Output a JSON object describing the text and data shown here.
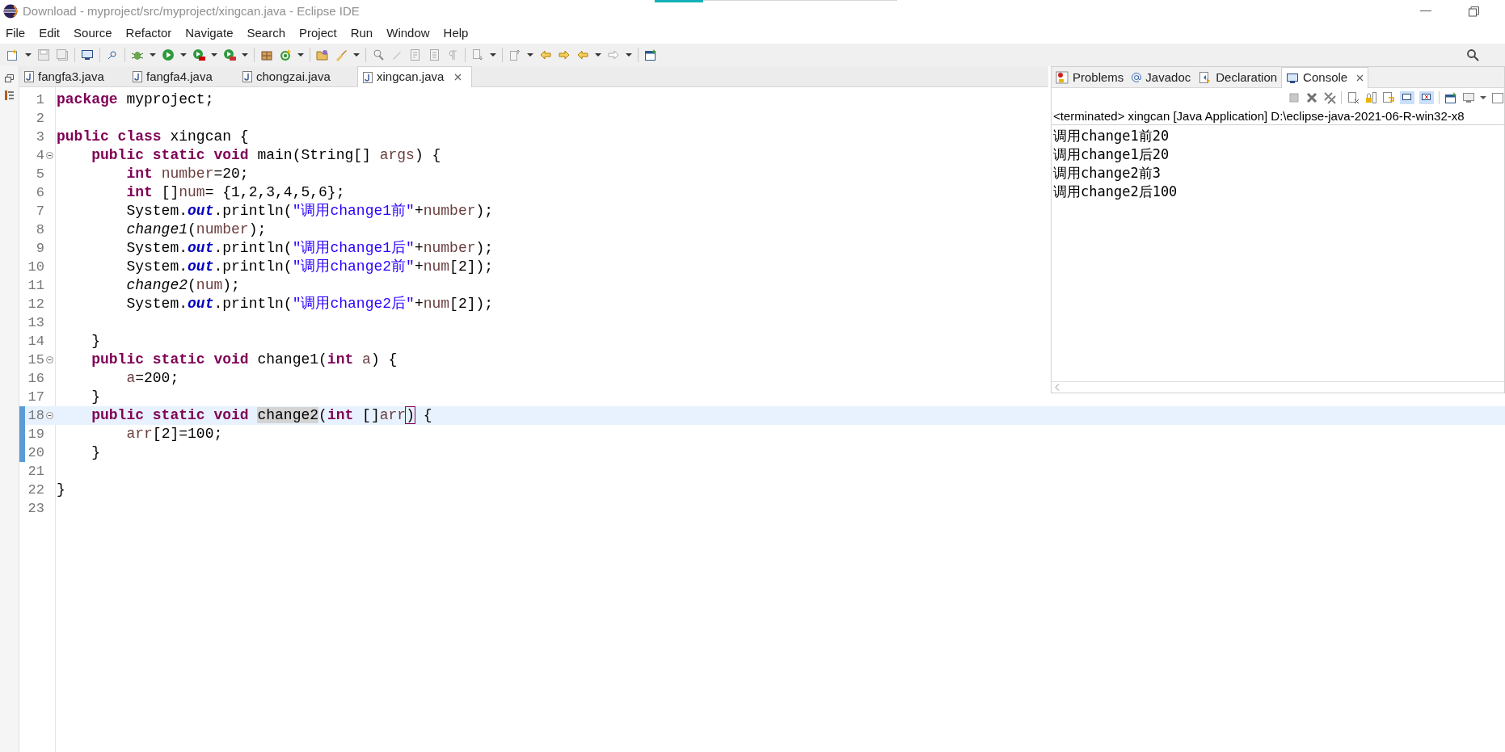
{
  "window": {
    "title": "Download - myproject/src/myproject/xingcan.java - Eclipse IDE"
  },
  "menu": [
    "File",
    "Edit",
    "Source",
    "Refactor",
    "Navigate",
    "Search",
    "Project",
    "Run",
    "Window",
    "Help"
  ],
  "editor_tabs": [
    {
      "label": "fangfa3.java",
      "selected": false
    },
    {
      "label": "fangfa4.java",
      "selected": false
    },
    {
      "label": "chongzai.java",
      "selected": false
    },
    {
      "label": "xingcan.java",
      "selected": true
    }
  ],
  "editor": {
    "lines": [
      {
        "number": "1",
        "fold": false,
        "changed": false,
        "current": false,
        "tokens": [
          {
            "kind": "keyword",
            "text": "package"
          },
          {
            "kind": "plain",
            "text": " myproject;"
          }
        ]
      },
      {
        "number": "2",
        "fold": false,
        "changed": false,
        "current": false
      },
      {
        "number": "3",
        "fold": false,
        "changed": false,
        "current": false,
        "tokens": [
          {
            "kind": "keyword",
            "text": "public class"
          },
          {
            "kind": "plain",
            "text": " xingcan {"
          }
        ]
      },
      {
        "number": "4",
        "fold": true,
        "changed": false,
        "current": false,
        "tokens": [
          {
            "kind": "keyword",
            "text": "    public static void"
          },
          {
            "kind": "plain",
            "text": " main(String[] "
          },
          {
            "kind": "variable",
            "text": "args"
          },
          {
            "kind": "plain",
            "text": ") {"
          }
        ]
      },
      {
        "number": "5",
        "fold": false,
        "changed": false,
        "current": false,
        "tokens": [
          {
            "kind": "keyword",
            "text": "        int "
          },
          {
            "kind": "variable",
            "text": "number"
          },
          {
            "kind": "plain",
            "text": "=20;"
          }
        ]
      },
      {
        "number": "6",
        "fold": false,
        "changed": false,
        "current": false,
        "tokens": [
          {
            "kind": "keyword",
            "text": "        int "
          },
          {
            "kind": "plain",
            "text": "[]"
          },
          {
            "kind": "variable",
            "text": "num"
          },
          {
            "kind": "plain",
            "text": "= {1,2,3,4,5,6};"
          }
        ]
      },
      {
        "number": "7",
        "fold": false,
        "changed": false,
        "current": false,
        "tokens": [
          {
            "kind": "plain",
            "text": "        System."
          },
          {
            "kind": "field",
            "text": "out"
          },
          {
            "kind": "plain",
            "text": ".println("
          },
          {
            "kind": "string",
            "text": "\"调用change1前\""
          },
          {
            "kind": "plain",
            "text": "+"
          },
          {
            "kind": "variable",
            "text": "number"
          },
          {
            "kind": "plain",
            "text": ");"
          }
        ]
      },
      {
        "number": "8",
        "fold": false,
        "changed": false,
        "current": false,
        "tokens": [
          {
            "kind": "static",
            "text": "        change1"
          },
          {
            "kind": "plain",
            "text": "("
          },
          {
            "kind": "variable",
            "text": "number"
          },
          {
            "kind": "plain",
            "text": ");"
          }
        ]
      },
      {
        "number": "9",
        "fold": false,
        "changed": false,
        "current": false,
        "tokens": [
          {
            "kind": "plain",
            "text": "        System."
          },
          {
            "kind": "field",
            "text": "out"
          },
          {
            "kind": "plain",
            "text": ".println("
          },
          {
            "kind": "string",
            "text": "\"调用change1后\""
          },
          {
            "kind": "plain",
            "text": "+"
          },
          {
            "kind": "variable",
            "text": "number"
          },
          {
            "kind": "plain",
            "text": ");"
          }
        ]
      },
      {
        "number": "10",
        "fold": false,
        "changed": false,
        "current": false,
        "tokens": [
          {
            "kind": "plain",
            "text": "        System."
          },
          {
            "kind": "field",
            "text": "out"
          },
          {
            "kind": "plain",
            "text": ".println("
          },
          {
            "kind": "string",
            "text": "\"调用change2前\""
          },
          {
            "kind": "plain",
            "text": "+"
          },
          {
            "kind": "variable",
            "text": "num"
          },
          {
            "kind": "plain",
            "text": "[2]);"
          }
        ]
      },
      {
        "number": "11",
        "fold": false,
        "changed": false,
        "current": false,
        "tokens": [
          {
            "kind": "static",
            "text": "        change2"
          },
          {
            "kind": "plain",
            "text": "("
          },
          {
            "kind": "variable",
            "text": "num"
          },
          {
            "kind": "plain",
            "text": ");"
          }
        ]
      },
      {
        "number": "12",
        "fold": false,
        "changed": false,
        "current": false,
        "tokens": [
          {
            "kind": "plain",
            "text": "        System."
          },
          {
            "kind": "field",
            "text": "out"
          },
          {
            "kind": "plain",
            "text": ".println("
          },
          {
            "kind": "string",
            "text": "\"调用change2后\""
          },
          {
            "kind": "plain",
            "text": "+"
          },
          {
            "kind": "variable",
            "text": "num"
          },
          {
            "kind": "plain",
            "text": "[2]);"
          }
        ]
      },
      {
        "number": "13",
        "fold": false,
        "changed": false,
        "current": false
      },
      {
        "number": "14",
        "fold": false,
        "changed": false,
        "current": false,
        "tokens": [
          {
            "kind": "plain",
            "text": "    }"
          }
        ]
      },
      {
        "number": "15",
        "fold": true,
        "changed": false,
        "current": false,
        "tokens": [
          {
            "kind": "keyword",
            "text": "    public static void"
          },
          {
            "kind": "plain",
            "text": " change1("
          },
          {
            "kind": "keyword",
            "text": "int "
          },
          {
            "kind": "variable",
            "text": "a"
          },
          {
            "kind": "plain",
            "text": ") {"
          }
        ]
      },
      {
        "number": "16",
        "fold": false,
        "changed": false,
        "current": false,
        "tokens": [
          {
            "kind": "variable",
            "text": "        a"
          },
          {
            "kind": "plain",
            "text": "=200;"
          }
        ]
      },
      {
        "number": "17",
        "fold": false,
        "changed": false,
        "current": false,
        "tokens": [
          {
            "kind": "plain",
            "text": "    }"
          }
        ]
      },
      {
        "number": "18",
        "fold": true,
        "changed": true,
        "current": true,
        "tokens": [
          {
            "kind": "keyword",
            "text": "    public static void "
          },
          {
            "kind": "occurrence",
            "text": "change2"
          },
          {
            "kind": "plain",
            "text": "("
          },
          {
            "kind": "keyword",
            "text": "int "
          },
          {
            "kind": "plain",
            "text": "[]"
          },
          {
            "kind": "variable",
            "text": "arr"
          },
          {
            "kind": "bracket",
            "text": ")"
          },
          {
            "kind": "plain",
            "text": " {"
          }
        ]
      },
      {
        "number": "19",
        "fold": false,
        "changed": true,
        "current": false,
        "tokens": [
          {
            "kind": "variable",
            "text": "        arr"
          },
          {
            "kind": "plain",
            "text": "[2]=100;"
          }
        ]
      },
      {
        "number": "20",
        "fold": false,
        "changed": true,
        "current": false,
        "tokens": [
          {
            "kind": "plain",
            "text": "    }"
          }
        ]
      },
      {
        "number": "21",
        "fold": false,
        "changed": false,
        "current": false
      },
      {
        "number": "22",
        "fold": false,
        "changed": false,
        "current": false,
        "tokens": [
          {
            "kind": "plain",
            "text": "}"
          }
        ]
      },
      {
        "number": "23",
        "fold": false,
        "changed": false,
        "current": false
      }
    ]
  },
  "view_tabs": [
    {
      "label": "Problems",
      "selected": false
    },
    {
      "label": "Javadoc",
      "selected": false
    },
    {
      "label": "Declaration",
      "selected": false
    },
    {
      "label": "Console",
      "selected": true
    }
  ],
  "console": {
    "header": "<terminated> xingcan [Java Application] D:\\eclipse-java-2021-06-R-win32-x8",
    "output": [
      "调用change1前20",
      "调用change1后20",
      "调用change2前3",
      "调用change2后100"
    ]
  }
}
